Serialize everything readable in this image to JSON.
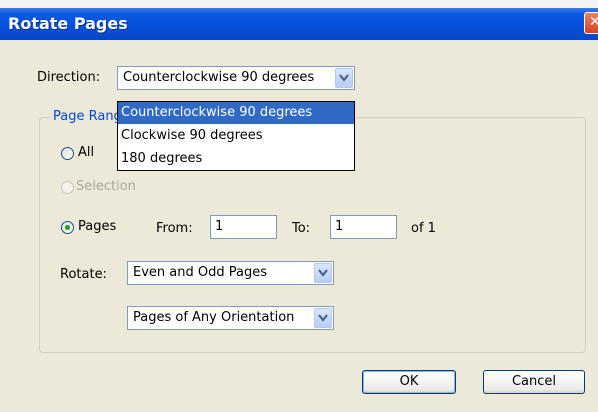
{
  "dialog": {
    "title": "Rotate Pages"
  },
  "direction": {
    "label": "Direction:",
    "selected": "Counterclockwise 90 degrees",
    "options": [
      "Counterclockwise 90 degrees",
      "Clockwise 90 degrees",
      "180 degrees"
    ]
  },
  "page_range": {
    "legend": "Page Rang",
    "all_label": "All",
    "selection_label": "Selection",
    "pages_label": "Pages",
    "from_label": "From:",
    "from_value": "1",
    "to_label": "To:",
    "to_value": "1",
    "of_text": "of 1",
    "selected_option": "Pages"
  },
  "rotate": {
    "label": "Rotate:",
    "parity_value": "Even and Odd Pages",
    "orientation_value": "Pages of Any Orientation"
  },
  "buttons": {
    "ok": "OK",
    "cancel": "Cancel"
  },
  "colors": {
    "titlebar": "#0550dc",
    "dialog_bg": "#ece9d8",
    "highlight": "#316ac5",
    "legend_text": "#0046d5"
  }
}
